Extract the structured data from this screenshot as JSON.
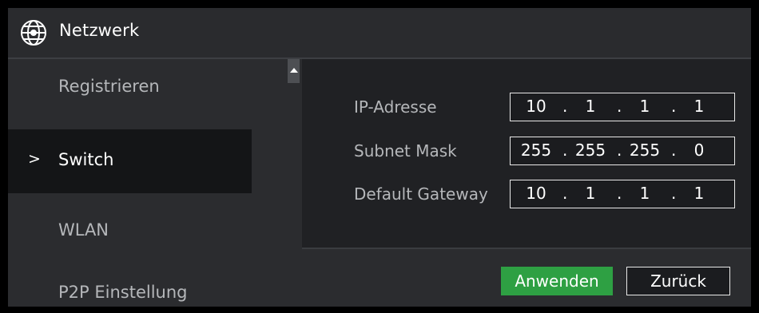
{
  "window": {
    "title": "Netzwerk",
    "icon": "network-globe-icon"
  },
  "sidebar": {
    "items": [
      {
        "label": "Registrieren",
        "active": false
      },
      {
        "label": "Switch",
        "active": true
      },
      {
        "label": "WLAN",
        "active": false
      },
      {
        "label": "P2P Einstellung",
        "active": false
      }
    ],
    "active_marker": ">"
  },
  "form": {
    "ip_address": {
      "label": "IP-Adresse",
      "octets": [
        "10",
        "1",
        "1",
        "1"
      ]
    },
    "subnet_mask": {
      "label": "Subnet Mask",
      "octets": [
        "255",
        "255",
        "255",
        "0"
      ]
    },
    "default_gateway": {
      "label": "Default Gateway",
      "octets": [
        "10",
        "1",
        "1",
        "1"
      ]
    },
    "separator": "."
  },
  "buttons": {
    "apply": "Anwenden",
    "back": "Zurück"
  },
  "colors": {
    "apply_button": "#2ea043",
    "active_item_bg": "#141517",
    "panel_bg": "#202124"
  }
}
